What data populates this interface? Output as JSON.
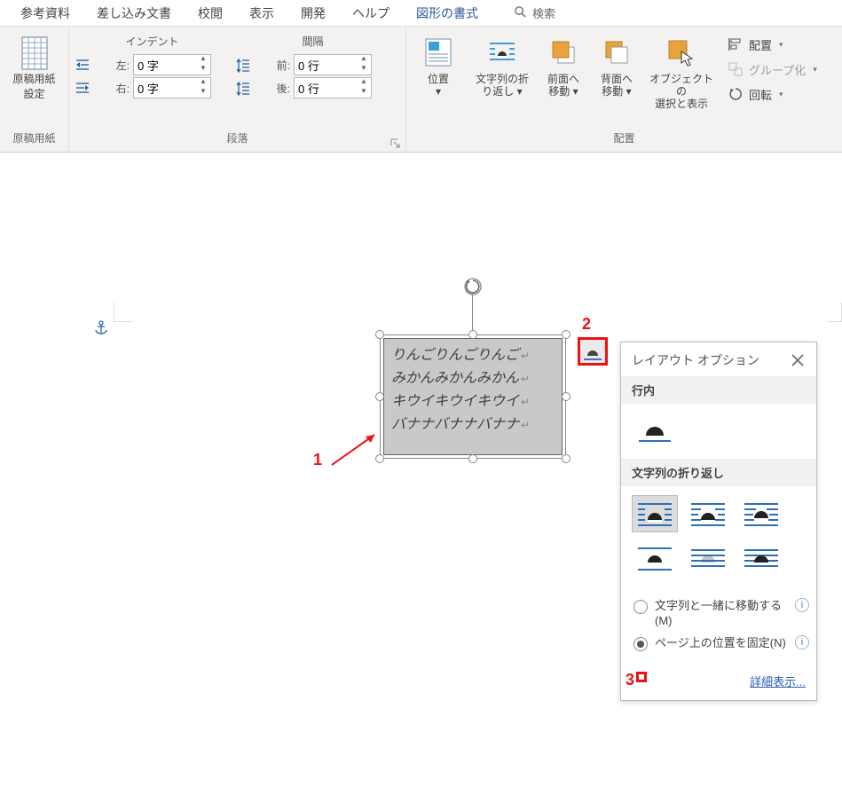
{
  "tabs": {
    "reference": "参考資料",
    "mailmerge": "差し込み文書",
    "review": "校閲",
    "view": "表示",
    "developer": "開発",
    "help": "ヘルプ",
    "shape_format": "図形の書式",
    "search": "検索"
  },
  "ribbon": {
    "genkou": {
      "button": "原稿用紙\n設定",
      "group": "原稿用紙"
    },
    "paragraph": {
      "indent_label": "インデント",
      "spacing_label": "間隔",
      "left_label": "左:",
      "right_label": "右:",
      "before_label": "前:",
      "after_label": "後:",
      "left_val": "0 字",
      "right_val": "0 字",
      "before_val": "0 行",
      "after_val": "0 行",
      "group": "段落"
    },
    "arrange": {
      "position": "位置",
      "wrap": "文字列の折\nり返し",
      "bring_forward": "前面へ\n移動",
      "send_backward": "背面へ\n移動",
      "selection_pane": "オブジェクトの\n選択と表示",
      "align": "配置",
      "group_btn": "グループ化",
      "rotate": "回転",
      "group": "配置"
    }
  },
  "textbox_lines": [
    "りんごりんごりんご",
    "みかんみかんみかん",
    "キウイキウイキウイ",
    "バナナバナナバナナ"
  ],
  "layout_panel": {
    "title": "レイアウト オプション",
    "inline": "行内",
    "wrap_title": "文字列の折り返し",
    "opt_move": "文字列と一緒に移動する(M)",
    "opt_fix": "ページ上の位置を固定(N)",
    "more": "詳細表示..."
  },
  "annotations": {
    "a1": "1",
    "a2": "2",
    "a3": "3"
  }
}
